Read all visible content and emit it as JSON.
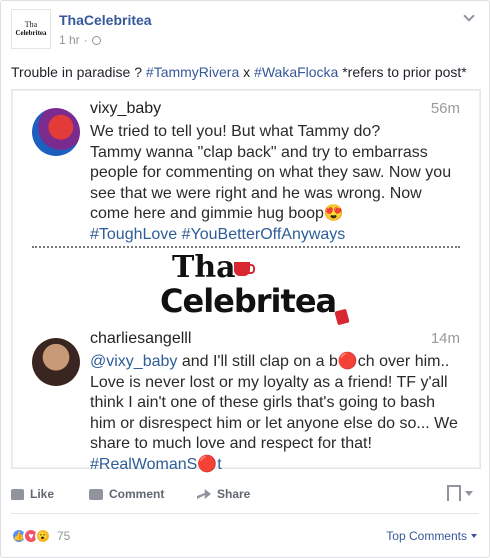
{
  "post": {
    "page_name": "ThaCelebritea",
    "avatar_line1": "Tha",
    "avatar_line2": "Celebritea",
    "time": "1 hr",
    "separator": "·"
  },
  "caption": {
    "prefix": "Trouble in paradise ? ",
    "tag1": "#TammyRivera",
    "mid": " x ",
    "tag2": "#WakaFlocka",
    "suffix": " *refers to prior post*"
  },
  "image": {
    "comment1": {
      "user": "vixy_baby",
      "time": "56m",
      "text": "We tried to tell you! But what Tammy do?\nTammy wanna \"clap back\" and try to embarrass people for commenting on what they saw. Now you see that we were right and he was wrong. Now come here and gimmie hug boop😍",
      "tags": "#ToughLove #YouBetterOffAnyways"
    },
    "logo_line1": "Tha",
    "logo_line2": "Celebritea",
    "comment2": {
      "user": "charliesangelll",
      "time": "14m",
      "mention": "@vixy_baby",
      "text": " and I'll still clap on a b🔴ch over him.. Love is never lost or my loyalty as a friend! TF y'all think I ain't one of these girls that's going to bash him or disrespect him or let anyone else do so... We share to much love and respect for that! ",
      "tag": "#RealWomanS🔴t"
    }
  },
  "actions": {
    "like": "Like",
    "comment": "Comment",
    "share": "Share"
  },
  "footer": {
    "reaction_count": "75",
    "top_comments": "Top Comments"
  },
  "colors": {
    "link": "#365899",
    "muted": "#90949c",
    "accent_red": "#d92732"
  }
}
